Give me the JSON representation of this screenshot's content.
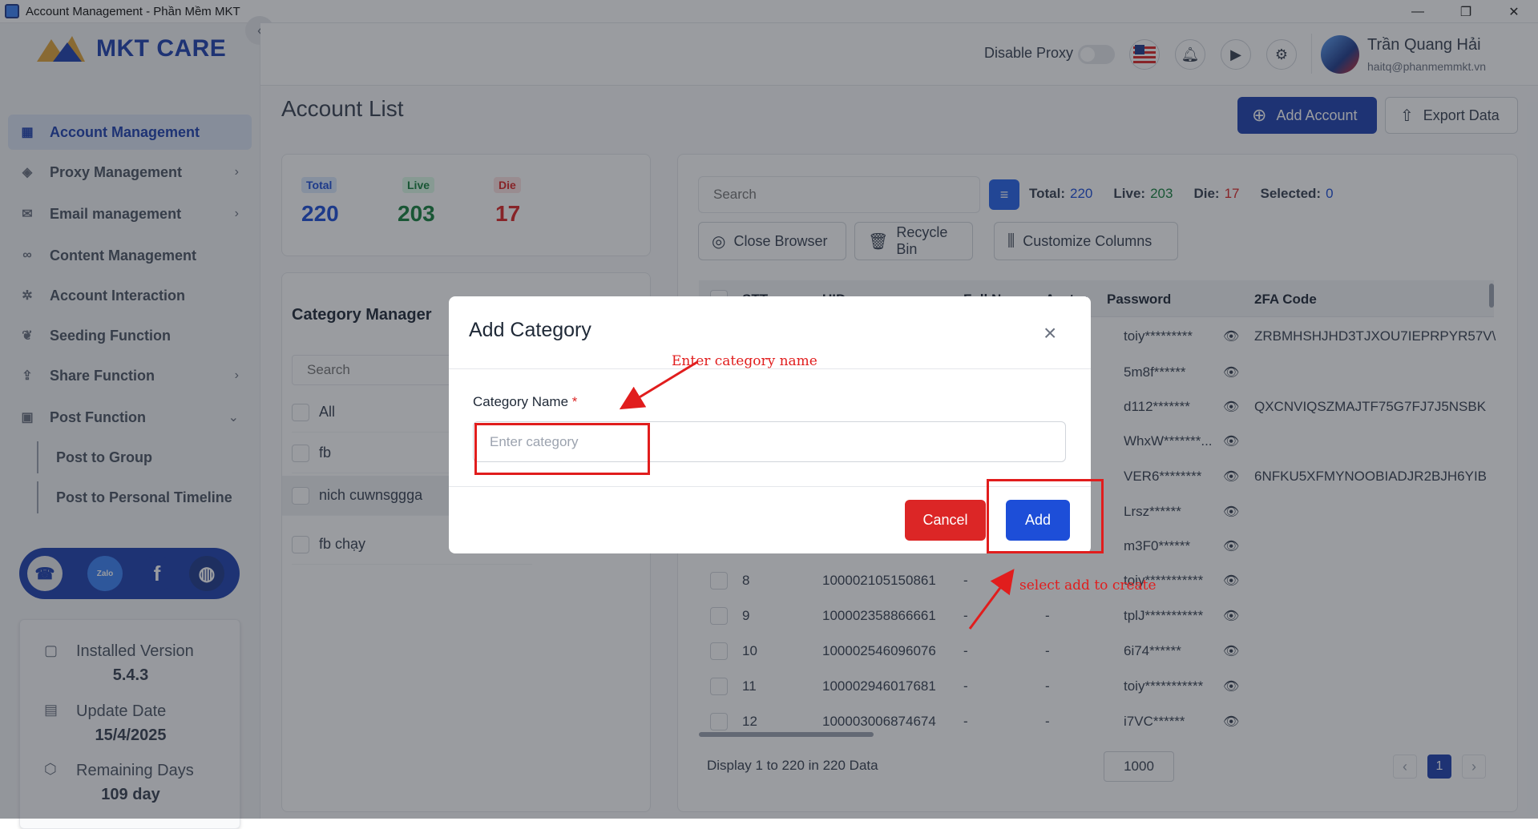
{
  "window": {
    "title": "Account Management - Phần Mềm MKT",
    "minimize": "—",
    "restore": "❐",
    "close": "✕"
  },
  "logo": {
    "text": "MKT CARE"
  },
  "sidebar": {
    "items": [
      {
        "label": "Account Management"
      },
      {
        "label": "Proxy Management"
      },
      {
        "label": "Email management"
      },
      {
        "label": "Content Management"
      },
      {
        "label": "Account Interaction"
      },
      {
        "label": "Seeding Function"
      },
      {
        "label": "Share Function"
      },
      {
        "label": "Post Function"
      }
    ],
    "subitems": [
      {
        "label": "Post to Group"
      },
      {
        "label": "Post to Personal Timeline"
      }
    ],
    "social": {
      "zalo": "Zalo"
    },
    "version": {
      "installed_label": "Installed Version",
      "installed_value": "5.4.3",
      "update_label": "Update Date",
      "update_value": "15/4/2025",
      "remaining_label": "Remaining Days",
      "remaining_value": "109 day"
    }
  },
  "header": {
    "disable_proxy": "Disable Proxy",
    "user_name": "Trần Quang Hải",
    "user_email": "haitq@phanmemmkt.vn"
  },
  "page": {
    "title": "Account List",
    "add_account": "Add Account",
    "export_data": "Export Data"
  },
  "stats": {
    "total_label": "Total",
    "total_value": "220",
    "live_label": "Live",
    "live_value": "203",
    "die_label": "Die",
    "die_value": "17"
  },
  "category_manager": {
    "title": "Category Manager",
    "search_placeholder": "Search",
    "items": [
      {
        "label": "All"
      },
      {
        "label": "fb"
      },
      {
        "label": "nich cuwnsggga"
      },
      {
        "label": "fb chạy"
      }
    ]
  },
  "toolbar": {
    "search_placeholder": "Search",
    "total_label": "Total:",
    "total_value": "220",
    "live_label": "Live:",
    "live_value": "203",
    "die_label": "Die:",
    "die_value": "17",
    "selected_label": "Selected:",
    "selected_value": "0",
    "close_browser": "Close Browser",
    "recycle_bin": "Recycle Bin",
    "customize_columns": "Customize Columns"
  },
  "table": {
    "headers": {
      "stt": "STT",
      "uid": "UID",
      "full_name": "Full N...",
      "avatar": "Avatar",
      "password": "Password",
      "twofa": "2FA Code"
    },
    "top_passwords": [
      {
        "password": "toiy*********",
        "twofa": "ZRBMHSHJHD3TJXOU7IEPRPYR57V\\"
      },
      {
        "password": "5m8f******",
        "twofa": ""
      },
      {
        "password": "d112*******",
        "twofa": "QXCNVIQSZMAJTF75G7FJ7J5NSBK"
      },
      {
        "password": "WhxW*******...",
        "twofa": ""
      },
      {
        "password": "VER6********",
        "twofa": "6NFKU5XFMYNOOBIADJR2BJH6YIB"
      },
      {
        "password": "Lrsz******",
        "twofa": ""
      },
      {
        "password": "m3F0******",
        "twofa": ""
      }
    ],
    "rows": [
      {
        "stt": "8",
        "uid": "100002105150861",
        "name": "-",
        "avatar": "",
        "password": "toiy***********"
      },
      {
        "stt": "9",
        "uid": "100002358866661",
        "name": "-",
        "avatar": "-",
        "password": "tplJ***********"
      },
      {
        "stt": "10",
        "uid": "100002546096076",
        "name": "-",
        "avatar": "-",
        "password": "6i74******"
      },
      {
        "stt": "11",
        "uid": "100002946017681",
        "name": "-",
        "avatar": "-",
        "password": "toiy***********"
      },
      {
        "stt": "12",
        "uid": "100003006874674",
        "name": "-",
        "avatar": "-",
        "password": "i7VC******"
      }
    ],
    "footer": {
      "display_text": "Display 1 to 220 in 220 Data",
      "page_size": "1000",
      "current_page": "1",
      "prev": "‹",
      "next": "›"
    }
  },
  "modal": {
    "title": "Add Category",
    "close": "×",
    "field_label": "Category Name",
    "required": "*",
    "placeholder": "Enter category",
    "cancel": "Cancel",
    "add": "Add"
  },
  "annotations": {
    "enter_name": "Enter category name",
    "select_add": "select add to create"
  },
  "colors": {
    "primary": "#1d4ed8",
    "danger": "#dc2626",
    "success": "#15803d",
    "annotation": "#e11d1d"
  }
}
